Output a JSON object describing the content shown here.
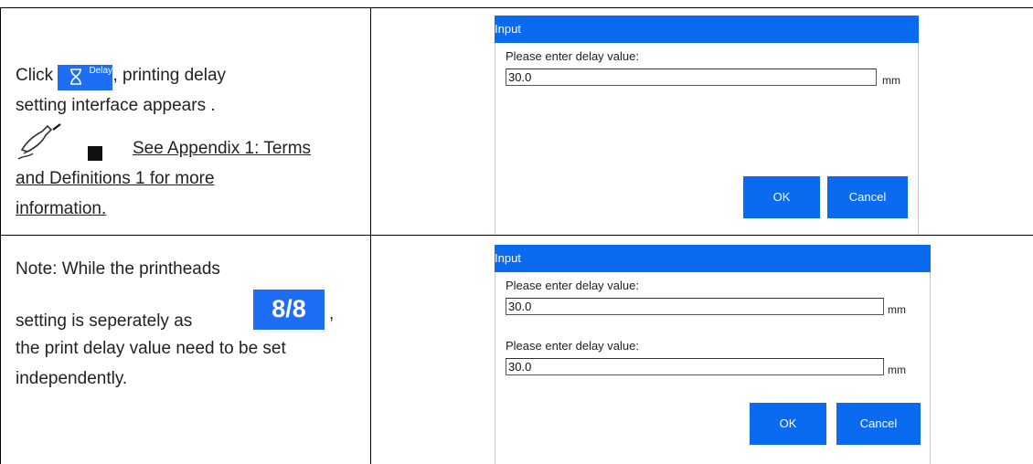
{
  "row1": {
    "click_word": "Click",
    "delay_icon_label": "Delay",
    "after_icon": ", printing delay",
    "line2": "setting interface appears .",
    "note_link_line1": "See Appendix 1: Terms",
    "note_link_line2": "and Definitions 1 for more",
    "note_link_line3": "information.",
    "dialog": {
      "title": "Input",
      "prompt": "Please enter delay value:",
      "value": "30.0",
      "unit": "mm",
      "ok_label": "OK",
      "cancel_label": "Cancel"
    }
  },
  "row2": {
    "line1": "Note: While the printheads",
    "line2_prefix": "setting is seperately as",
    "printheads_icon_text": "8/8",
    "line2_suffix": ",",
    "line3": "the print delay value need to be set",
    "line4": "independently.",
    "dialog": {
      "title": "Input",
      "prompt1": "Please enter delay value:",
      "value1": "30.0",
      "unit1": "mm",
      "prompt2": "Please enter delay value:",
      "value2": "30.0",
      "unit2": "mm",
      "ok_label": "OK",
      "cancel_label": "Cancel"
    }
  },
  "icons": {
    "delay": "hourglass-icon",
    "note": "pen-writing-icon",
    "printheads": "printheads-icon"
  },
  "colors": {
    "accent": "#0a6af0",
    "chip": "#1d6ef5"
  }
}
